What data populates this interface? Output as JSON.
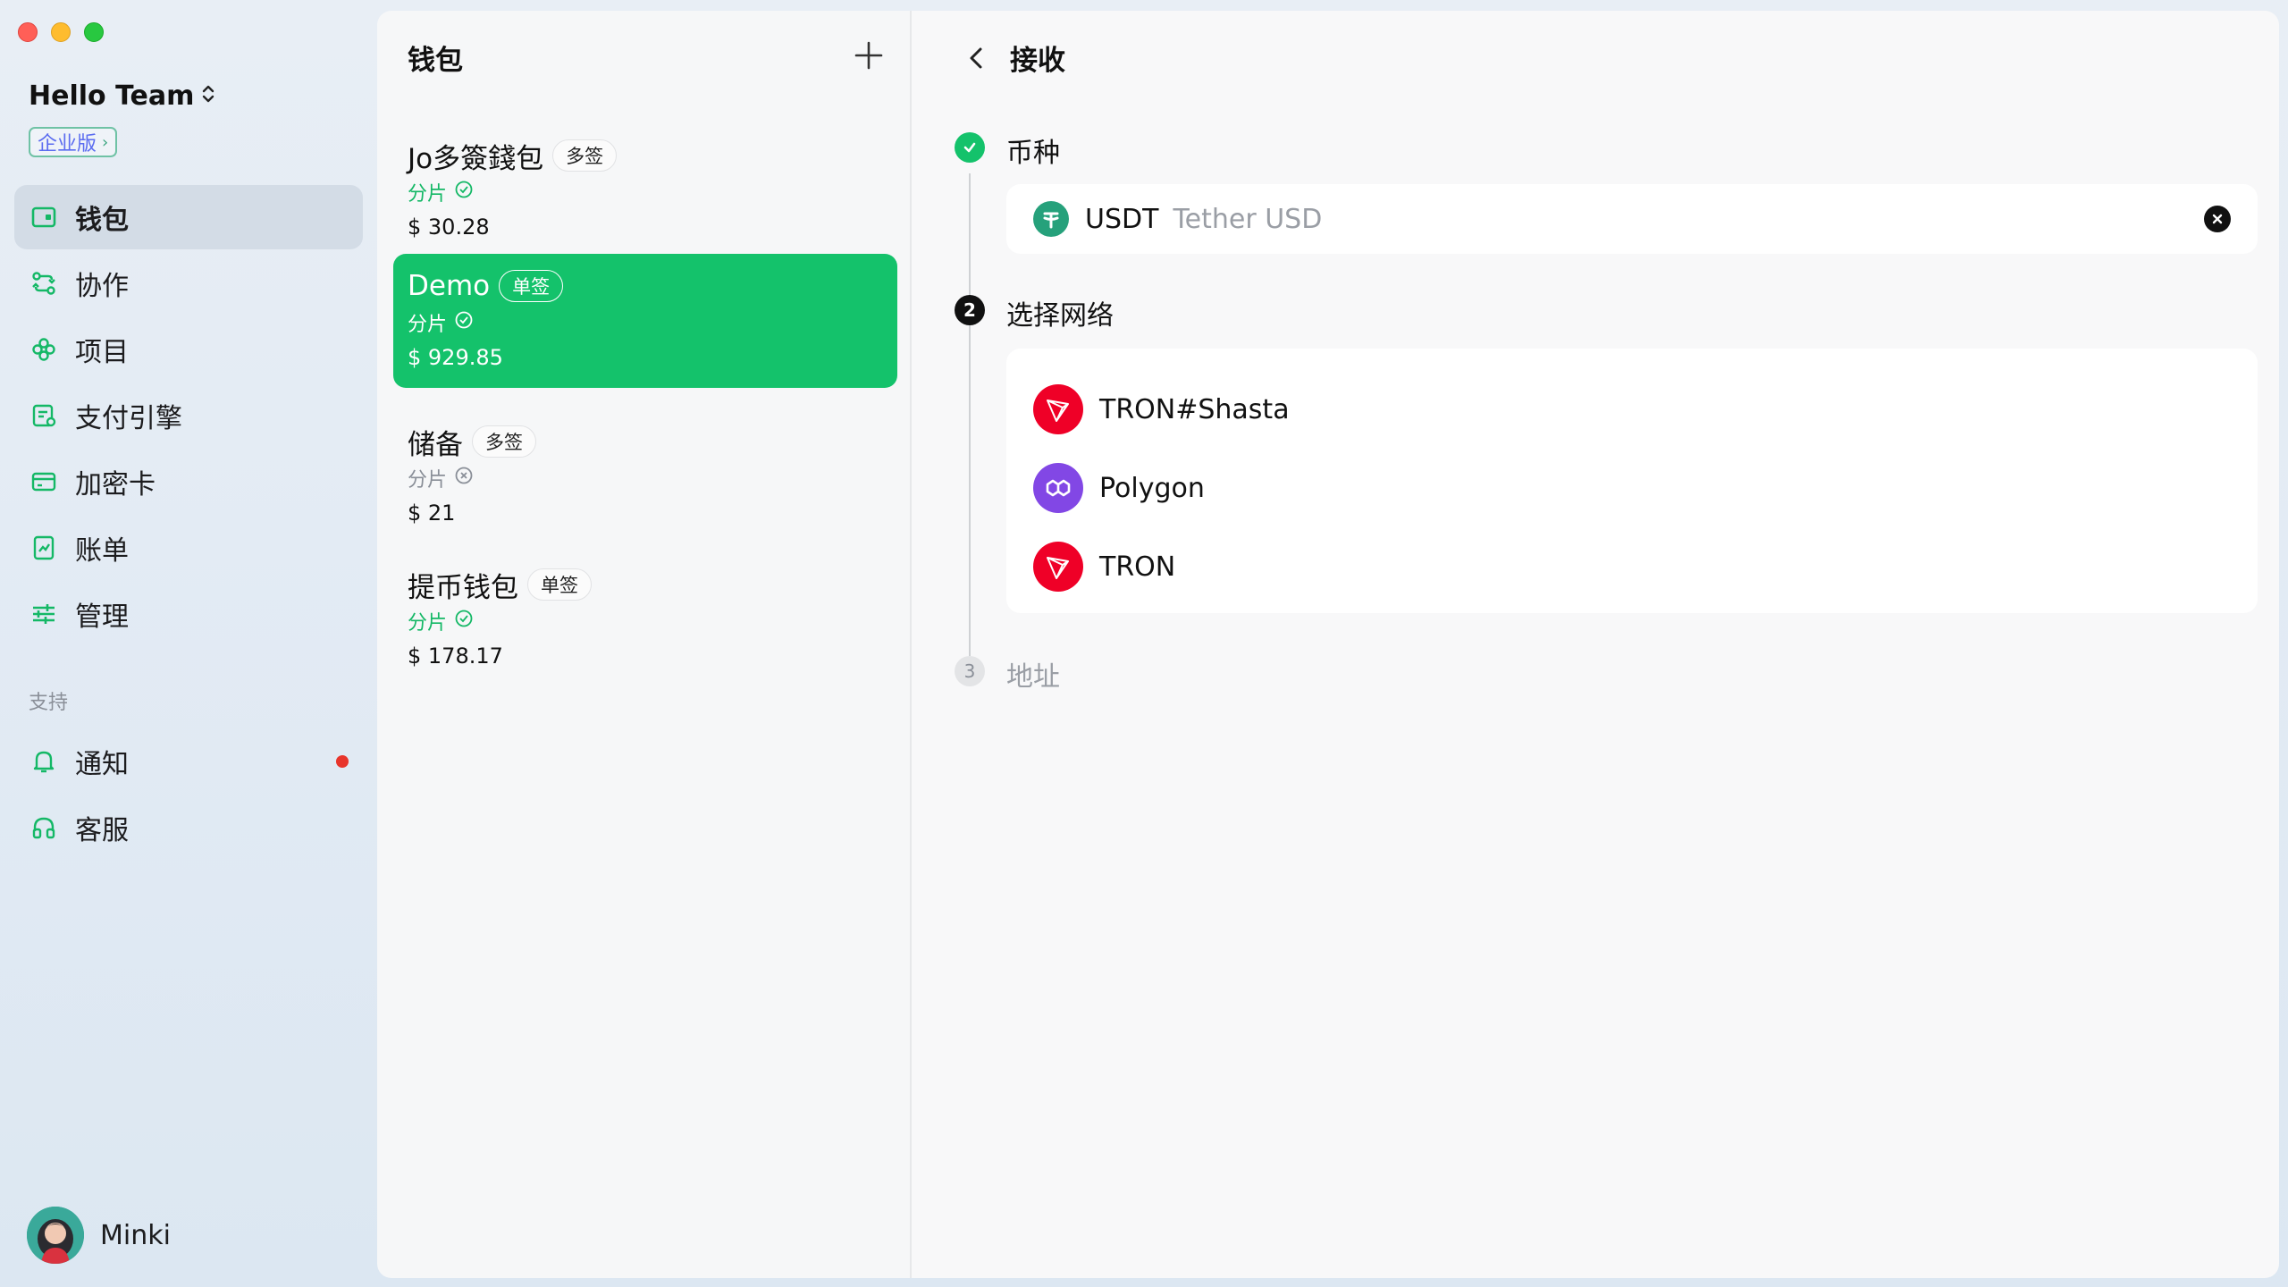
{
  "sidebar": {
    "team_name": "Hello Team",
    "edition": "企业版",
    "nav": [
      {
        "label": "钱包",
        "icon": "wallet-icon",
        "active": true
      },
      {
        "label": "协作",
        "icon": "collaboration-icon"
      },
      {
        "label": "项目",
        "icon": "project-icon"
      },
      {
        "label": "支付引擎",
        "icon": "payment-engine-icon"
      },
      {
        "label": "加密卡",
        "icon": "crypto-card-icon"
      },
      {
        "label": "账单",
        "icon": "bill-icon"
      },
      {
        "label": "管理",
        "icon": "manage-icon"
      }
    ],
    "support_label": "支持",
    "support": [
      {
        "label": "通知",
        "icon": "bell-icon",
        "badge": true
      },
      {
        "label": "客服",
        "icon": "headset-icon"
      }
    ],
    "user_name": "Minki"
  },
  "wallets": {
    "title": "钱包",
    "items": [
      {
        "name": "Jo多簽錢包",
        "tag": "多签",
        "sub": "分片",
        "status": "check",
        "amount": "$ 30.28"
      },
      {
        "name": "Demo",
        "tag": "单签",
        "sub": "分片",
        "status": "check",
        "amount": "$ 929.85",
        "selected": true
      },
      {
        "name": "储备",
        "tag": "多签",
        "sub": "分片",
        "status": "x",
        "amount": "$ 21"
      },
      {
        "name": "提币钱包",
        "tag": "单签",
        "sub": "分片",
        "status": "check",
        "amount": "$ 178.17"
      }
    ]
  },
  "main": {
    "title": "接收",
    "steps": [
      {
        "label": "币种",
        "state": "done"
      },
      {
        "label": "选择网络",
        "number": "2",
        "state": "active"
      },
      {
        "label": "地址",
        "number": "3",
        "state": "pending"
      }
    ],
    "coin": {
      "symbol": "USDT",
      "name": "Tether USD"
    },
    "networks": [
      {
        "name": "TRON#Shasta",
        "icon": "tron-icon"
      },
      {
        "name": "Polygon",
        "icon": "polygon-icon"
      },
      {
        "name": "TRON",
        "icon": "tron-icon"
      }
    ]
  },
  "colors": {
    "accent": "#14c26b",
    "tron": "#ef0027",
    "polygon": "#8247e5",
    "usdt": "#26a17b",
    "notification": "#e8352b"
  }
}
